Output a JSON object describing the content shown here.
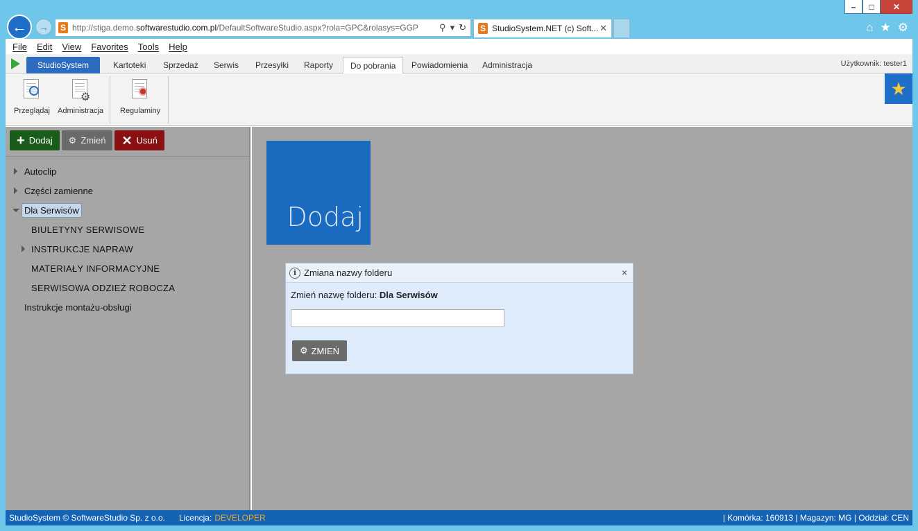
{
  "browser": {
    "url_prefix": "http://stiga.demo.",
    "url_domain": "softwarestudio.com.pl",
    "url_suffix": "/DefaultSoftwareStudio.aspx?rola=GPC&rolasys=GGP",
    "tab_title": "StudioSystem.NET (c) Soft...",
    "tab_close": "✕",
    "menu": [
      "File",
      "Edit",
      "View",
      "Favorites",
      "Tools",
      "Help"
    ]
  },
  "nav": {
    "brand": "StudioSystem",
    "tabs": [
      "Kartoteki",
      "Sprzedaż",
      "Serwis",
      "Przesyłki",
      "Raporty",
      "Do pobrania",
      "Powiadomienia",
      "Administracja"
    ],
    "active_tab": "Do pobrania",
    "user_label": "Użytkownik: tester1"
  },
  "ribbon": {
    "buttons": [
      "Przeglądaj",
      "Administracja",
      "Regulaminy"
    ]
  },
  "toolbar": {
    "add_label": "Dodaj",
    "edit_label": "Zmień",
    "delete_label": "Usuń"
  },
  "tree": {
    "items": [
      {
        "label": "Autoclip",
        "level": 0,
        "caret": "right"
      },
      {
        "label": "Części zamienne",
        "level": 0,
        "caret": "right"
      },
      {
        "label": "Dla Serwisów",
        "level": 0,
        "caret": "down",
        "selected": true
      },
      {
        "label": "BIULETYNY SERWISOWE",
        "level": 1,
        "caret": ""
      },
      {
        "label": "INSTRUKCJE NAPRAW",
        "level": 1,
        "caret": "right"
      },
      {
        "label": "MATERIAŁY INFORMACYJNE",
        "level": 1,
        "caret": ""
      },
      {
        "label": "SERWISOWA ODZIEŻ ROBOCZA",
        "level": 1,
        "caret": ""
      },
      {
        "label": "Instrukcje montażu-obsługi",
        "level": 0,
        "caret": ""
      }
    ]
  },
  "tile": {
    "label": "Dodaj"
  },
  "dialog": {
    "title": "Zmiana nazwy folderu",
    "message_prefix": "Zmień nazwę folderu:",
    "folder_name": "Dla Serwisów",
    "input_value": "",
    "button_label": "ZMIEŃ",
    "close": "×"
  },
  "status": {
    "copyright": "StudioSystem © SoftwareStudio Sp. z o.o.",
    "license_label": "Licencja:",
    "license_value": "DEVELOPER",
    "right_text": "| Komórka: 160913 | Magazyn: MG | Oddział: CEN"
  }
}
